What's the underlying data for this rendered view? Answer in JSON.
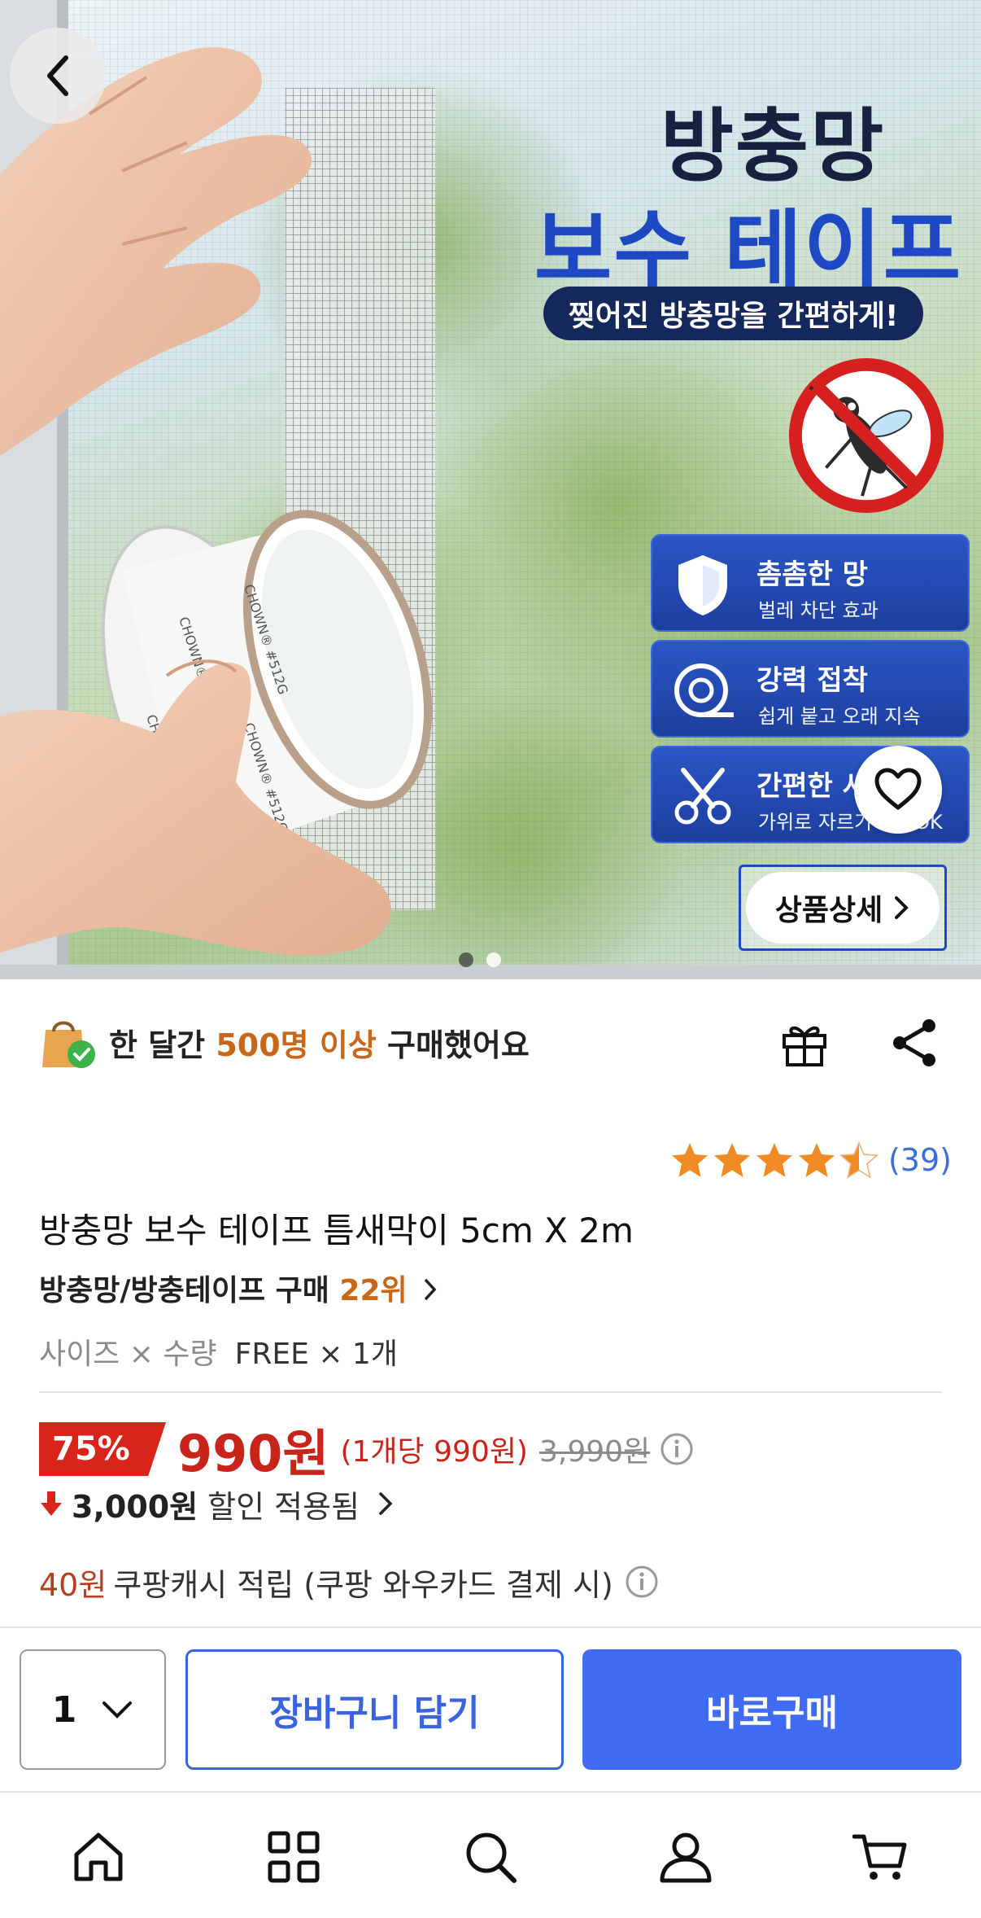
{
  "hero": {
    "title_line1": "방충망",
    "title_line2": "보수 테이프",
    "tagline": "찢어진 방충망을 간편하게!",
    "features": [
      {
        "title": "촘촘한 망",
        "desc": "벌레 차단 효과",
        "icon": "shield-icon"
      },
      {
        "title": "강력 접착",
        "desc": "쉽게 붙고 오래 지속",
        "icon": "tape-roll-icon"
      },
      {
        "title": "간편한 사",
        "desc": "가위로 자르기",
        "desc_tail": "OK",
        "icon": "scissors-icon"
      }
    ],
    "detail_button": "상품상세",
    "tape_print": "CHOWN® #512G",
    "page_dots": 2,
    "active_dot": 1
  },
  "social_proof": {
    "prefix": "한 달간 ",
    "highlight": "500명 이상",
    "suffix": " 구매했어요"
  },
  "rating": {
    "value": 4.5,
    "max": 5,
    "count_text": "(39)"
  },
  "product": {
    "title": "방충망 보수 테이프 틈새막이 5cm X 2m",
    "rank_prefix": "방충망/방충테이프 구매 ",
    "rank_value": "22위",
    "option_key": "사이즈 × 수량",
    "option_value": "FREE × 1개"
  },
  "price": {
    "discount_rate": "75%",
    "sale_price": "990원",
    "unit_price": "(1개당 990원)",
    "original_price": "3,990원",
    "discount_amount": "3,000원",
    "discount_label": "할인 적용됨"
  },
  "cashback": {
    "amount": "40원",
    "label": "쿠팡캐시 적립 (쿠팡 와우카드 결제 시)"
  },
  "buy_bar": {
    "quantity": "1",
    "cart_label": "장바구니 담기",
    "buy_label": "바로구매"
  },
  "tabs": [
    "home-icon",
    "category-icon",
    "search-icon",
    "my-account-icon",
    "cart-icon"
  ],
  "colors": {
    "accent_blue": "#3f6cf3",
    "sale_red": "#c8241a",
    "highlight_orange": "#c8661a",
    "star": "#f08a24",
    "review_blue": "#3a6fd6"
  }
}
